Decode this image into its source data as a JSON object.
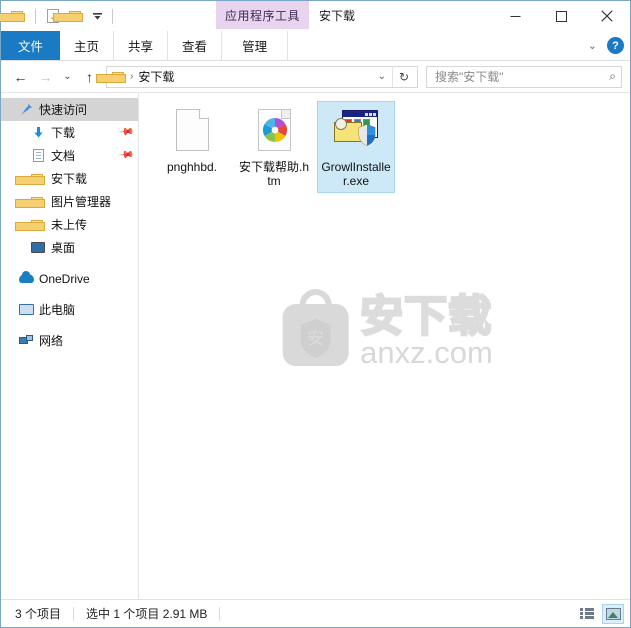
{
  "window": {
    "title": "安下载",
    "contextual_tab_header": "应用程序工具",
    "controls": {
      "minimize": "—",
      "maximize": "□",
      "close": "✕"
    }
  },
  "quick_access_toolbar": {
    "items": [
      {
        "name": "folder-icon",
        "label": ""
      },
      {
        "name": "properties-icon",
        "label": ""
      },
      {
        "name": "new-folder-icon",
        "label": ""
      },
      {
        "name": "customize-dropdown",
        "label": "▾"
      }
    ]
  },
  "ribbon": {
    "tabs": [
      {
        "label": "文件",
        "active": true
      },
      {
        "label": "主页",
        "active": false
      },
      {
        "label": "共享",
        "active": false
      },
      {
        "label": "查看",
        "active": false
      },
      {
        "label": "管理",
        "active": false
      }
    ],
    "collapse_chevron": "⌄",
    "help_label": "?"
  },
  "address_bar": {
    "back": "←",
    "forward": "→",
    "recent": "⌄",
    "up": "↑",
    "breadcrumb_separator": "›",
    "path": "安下载",
    "dropdown": "⌄",
    "refresh": "↻"
  },
  "search": {
    "placeholder": "搜索\"安下载\"",
    "icon": "⌕"
  },
  "sidebar": {
    "items": [
      {
        "label": "快速访问",
        "icon": "pin-star-icon",
        "level": 0,
        "selected": true,
        "pinned": false
      },
      {
        "label": "下载",
        "icon": "downloads-icon",
        "level": 1,
        "selected": false,
        "pinned": true
      },
      {
        "label": "文档",
        "icon": "documents-icon",
        "level": 1,
        "selected": false,
        "pinned": true
      },
      {
        "label": "安下载",
        "icon": "folder-icon",
        "level": 1,
        "selected": false,
        "pinned": false
      },
      {
        "label": "图片管理器",
        "icon": "folder-icon",
        "level": 1,
        "selected": false,
        "pinned": false
      },
      {
        "label": "未上传",
        "icon": "folder-icon",
        "level": 1,
        "selected": false,
        "pinned": false
      },
      {
        "label": "桌面",
        "icon": "desktop-icon",
        "level": 1,
        "selected": false,
        "pinned": false
      },
      {
        "label": "OneDrive",
        "icon": "cloud-icon",
        "level": 0,
        "selected": false,
        "pinned": false
      },
      {
        "label": "此电脑",
        "icon": "this-pc-icon",
        "level": 0,
        "selected": false,
        "pinned": false
      },
      {
        "label": "网络",
        "icon": "network-icon",
        "level": 0,
        "selected": false,
        "pinned": false
      }
    ]
  },
  "files": [
    {
      "name": "pnghhbd.",
      "icon": "blank-document-icon",
      "selected": false
    },
    {
      "name": "安下载帮助.htm",
      "icon": "html-document-icon",
      "selected": false
    },
    {
      "name": "GrowlInstaller.exe",
      "icon": "installer-exe-icon",
      "selected": true
    }
  ],
  "watermark": {
    "shield_char": "安",
    "chinese": "安下载",
    "domain": "anxz.com"
  },
  "status_bar": {
    "item_count": "3 个项目",
    "selection": "选中 1 个项目  2.91 MB",
    "views": [
      {
        "name": "details-view",
        "active": false
      },
      {
        "name": "large-icons-view",
        "active": true
      }
    ]
  },
  "colors": {
    "accent": "#1b7ac4",
    "selection": "#cde8f7",
    "contextual_tab": "#e9d4ef",
    "window_border": "#7ba7c7"
  }
}
